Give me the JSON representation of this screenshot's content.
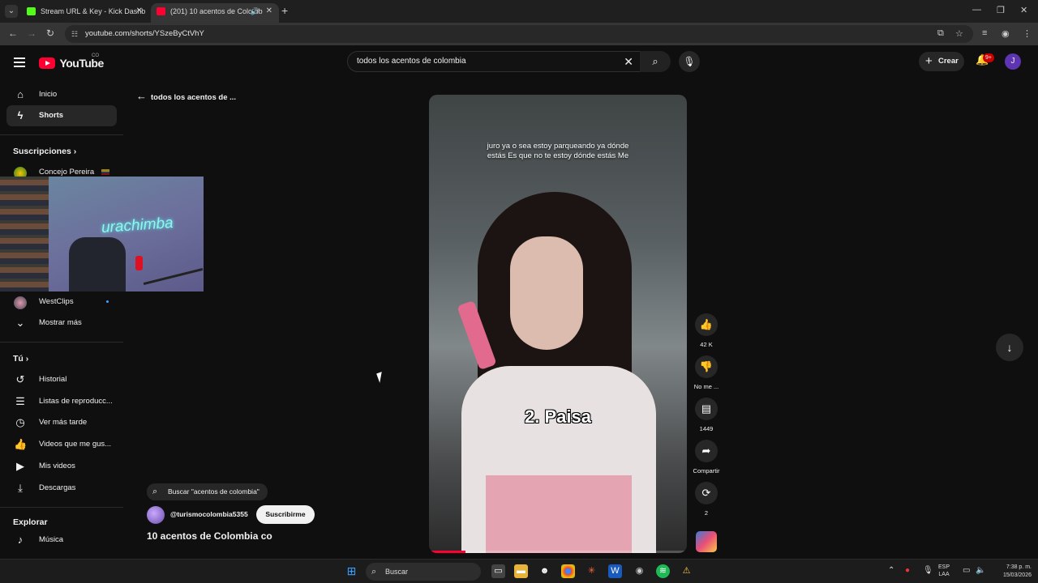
{
  "browser": {
    "tabs": [
      {
        "title": "Stream URL & Key - Kick Dashb",
        "favicon_color": "#53fc18"
      },
      {
        "title": "(201) 10 acentos de Colomb",
        "favicon_color": "#ff0033"
      }
    ],
    "url": "youtube.com/shorts/YSzeByCtVhY"
  },
  "youtube": {
    "logo_text": "YouTube",
    "country": "CO",
    "search_value": "todos los acentos de colombia",
    "create_label": "Crear",
    "notifications": "9+",
    "avatar_initial": "J"
  },
  "sidebar": {
    "main": [
      {
        "label": "Inicio",
        "icon": "home-icon"
      },
      {
        "label": "Shorts",
        "icon": "shorts-icon"
      }
    ],
    "subs_heading": "Suscripciones",
    "subs": [
      {
        "label": "Concejo Pereira"
      },
      {
        "label": "WestClips"
      }
    ],
    "show_more": "Mostrar más",
    "you_heading": "Tú",
    "you": [
      {
        "label": "Historial"
      },
      {
        "label": "Listas de reproducc..."
      },
      {
        "label": "Ver más tarde"
      },
      {
        "label": "Videos que me gus..."
      },
      {
        "label": "Mis videos"
      },
      {
        "label": "Descargas"
      }
    ],
    "explore_heading": "Explorar",
    "explore": [
      {
        "label": "Música"
      }
    ]
  },
  "shorts": {
    "back_label": "todos los acentos de ...",
    "caption": "juro ya o sea estoy parqueando ya dónde estás Es que no te estoy dónde estás Me",
    "overlay_title": "2. Paisa",
    "progress": 0.14,
    "likes": "42 K",
    "dislike_label": "No me ...",
    "comments": "1449",
    "share_label": "Compartir",
    "remix_count": "2",
    "search_chip": "Buscar \"acentos de colombia\"",
    "channel": "@turismocolombia5355",
    "subscribe_label": "Suscribirme",
    "video_title": "10 acentos de Colombia co"
  },
  "taskbar": {
    "search_placeholder": "Buscar",
    "lang_top": "ESP",
    "lang_bottom": "LAA",
    "time": "7:38 p. m.",
    "date": "15/03/2026"
  }
}
